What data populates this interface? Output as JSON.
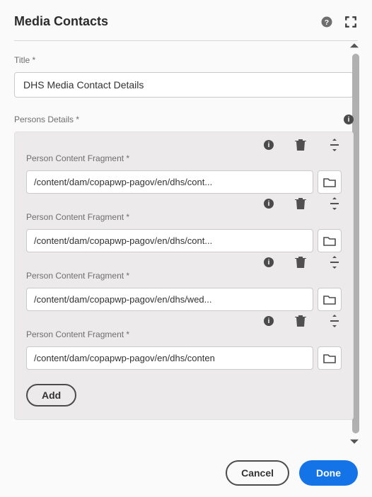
{
  "header": {
    "title": "Media Contacts"
  },
  "title_field": {
    "label": "Title *",
    "value": "DHS Media Contact Details"
  },
  "persons_group": {
    "label": "Persons Details *",
    "item_label": "Person Content Fragment *",
    "items": [
      {
        "path": "/content/dam/copapwp-pagov/en/dhs/cont..."
      },
      {
        "path": "/content/dam/copapwp-pagov/en/dhs/cont..."
      },
      {
        "path": "/content/dam/copapwp-pagov/en/dhs/wed..."
      },
      {
        "path": "/content/dam/copapwp-pagov/en/dhs/conten"
      }
    ],
    "add_label": "Add"
  },
  "footer": {
    "cancel": "Cancel",
    "done": "Done"
  }
}
